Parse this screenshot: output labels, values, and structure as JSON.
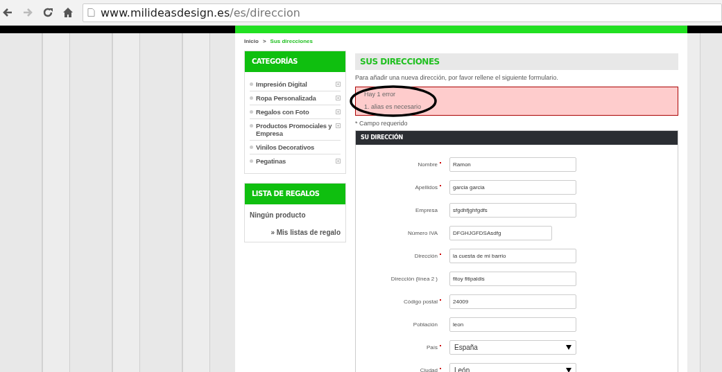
{
  "browser": {
    "url": {
      "host": "www.milideasdesign.es",
      "path": "/es/direccion"
    }
  },
  "breadcrumb": [
    {
      "label": "Inicio",
      "current": false
    },
    {
      "label": "Sus direcciones",
      "current": true
    }
  ],
  "breadcrumb_separator": ">",
  "sidebar": {
    "categories": {
      "title": "CATEGORÍAS",
      "items": [
        {
          "label": "Impresión Digital",
          "expandable": true
        },
        {
          "label": "Ropa Personalizada",
          "expandable": true
        },
        {
          "label": "Regalos con Foto",
          "expandable": true
        },
        {
          "label": "Productos Promociales y Empresa",
          "expandable": true
        },
        {
          "label": "Vinilos Decorativos",
          "expandable": false
        },
        {
          "label": "Pegatinas",
          "expandable": true
        }
      ]
    },
    "gift_list": {
      "title": "LISTA DE REGALOS",
      "empty_text": "Ningún producto",
      "link": "» Mis listas de regalo"
    }
  },
  "main": {
    "title": "SUS DIRECCIONES",
    "intro": "Para añadir una nueva dirección, por favor rellene el siguiente formulario.",
    "error": {
      "heading": "Hay 1 error",
      "items": [
        "1.  alias es necesario"
      ]
    },
    "required_note": "* Campo requerido",
    "form": {
      "title": "SU DIRECCIÓN",
      "fields": [
        {
          "kind": "text",
          "label": "Nombre",
          "required": true,
          "value": "Ramon",
          "short": false
        },
        {
          "kind": "text",
          "label": "Apellidos",
          "required": true,
          "value": "garcia garcia",
          "short": false
        },
        {
          "kind": "text",
          "label": "Empresa",
          "required": false,
          "value": "sfgdhfjghfgdfs",
          "short": false
        },
        {
          "kind": "text",
          "label": "Número IVA",
          "required": false,
          "value": "DFGHJGFDSAsdfg",
          "short": true
        },
        {
          "kind": "text",
          "label": "Dirección",
          "required": true,
          "value": "la cuesta de mi barrio",
          "short": false
        },
        {
          "kind": "text",
          "label": "Dirección (línea 2 )",
          "required": false,
          "value": "fitoy fitipaldis",
          "short": false
        },
        {
          "kind": "text",
          "label": "Código postal",
          "required": true,
          "value": "24009",
          "short": false
        },
        {
          "kind": "text",
          "label": "Población",
          "required": false,
          "value": "leon",
          "short": false
        },
        {
          "kind": "select",
          "label": "País",
          "required": true,
          "value": "España",
          "short": false
        },
        {
          "kind": "select",
          "label": "Ciudad",
          "required": true,
          "value": "León",
          "short": false
        }
      ]
    }
  },
  "annotation": {
    "kind": "ellipse"
  }
}
